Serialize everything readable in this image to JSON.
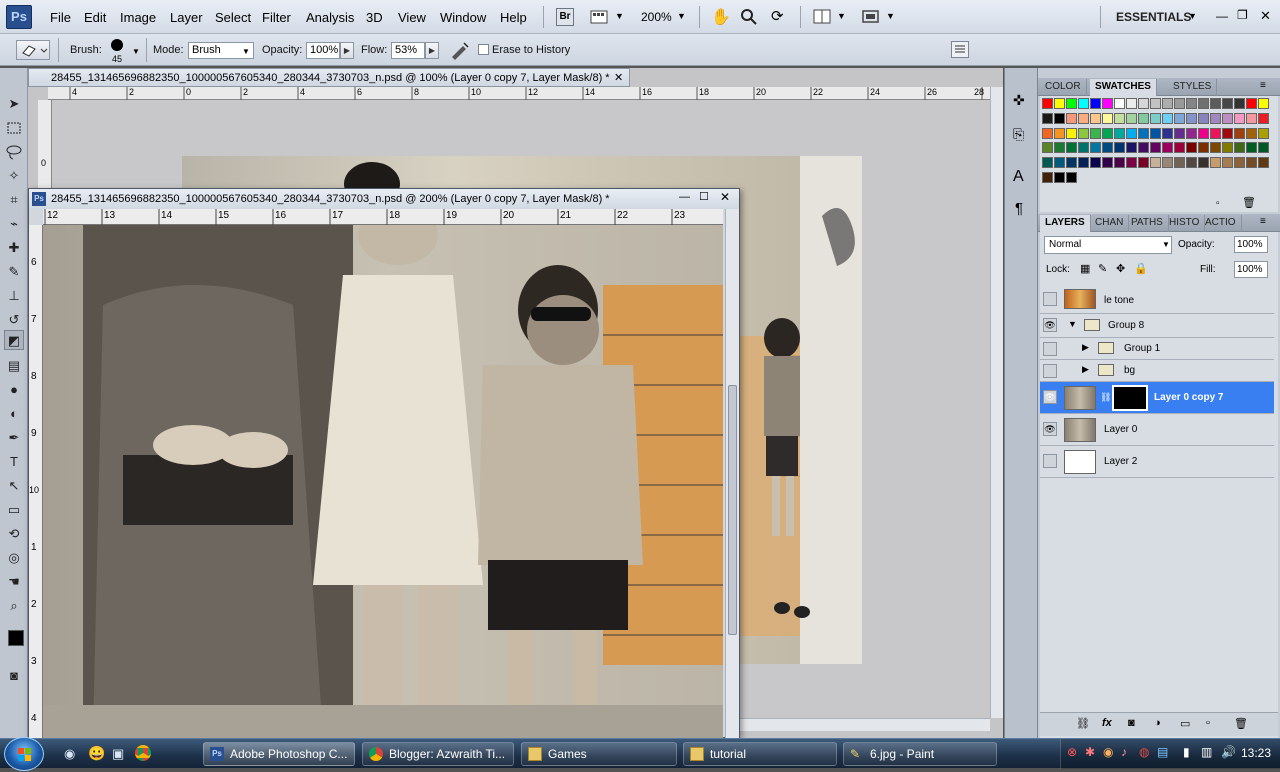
{
  "app": {
    "logo_text": "Ps",
    "menu": [
      "File",
      "Edit",
      "Image",
      "Layer",
      "Select",
      "Filter",
      "Analysis",
      "3D",
      "View",
      "Window",
      "Help"
    ],
    "br_label": "Br",
    "zoom_level": "200%",
    "workspace": "ESSENTIALS"
  },
  "options": {
    "brush_label": "Brush:",
    "brush_size": "45",
    "mode_label": "Mode:",
    "mode_value": "Brush",
    "opacity_label": "Opacity:",
    "opacity_value": "100%",
    "flow_label": "Flow:",
    "flow_value": "53%",
    "erase_history": "Erase to History"
  },
  "documents": {
    "back_title": "28455_131465696882350_100000567605340_280344_3730703_n.psd @ 100% (Layer 0 copy 7, Layer Mask/8) *",
    "front_title": "28455_131465696882350_100000567605340_280344_3730703_n.psd @ 200% (Layer 0 copy 7, Layer Mask/8) *",
    "back_ruler": [
      "4",
      "2",
      "0",
      "2",
      "4",
      "6",
      "8",
      "10",
      "12",
      "14",
      "16",
      "18",
      "20",
      "22",
      "24",
      "26",
      "28"
    ],
    "back_ruler_v": [
      "0"
    ],
    "front_ruler": [
      "12",
      "13",
      "14",
      "15",
      "16",
      "17",
      "18",
      "19",
      "20",
      "21",
      "22",
      "23"
    ],
    "front_ruler_v": [
      "6",
      "7",
      "8",
      "9",
      "10",
      "1",
      "2",
      "3",
      "4"
    ]
  },
  "panels": {
    "top_tabs": [
      "COLOR",
      "SWATCHES",
      "STYLES"
    ],
    "layer_tabs": [
      "LAYERS",
      "CHAN",
      "PATHS",
      "HISTO",
      "ACTIO"
    ],
    "blend_mode": "Normal",
    "opacity_label": "Opacity:",
    "opacity_value": "100%",
    "lock_label": "Lock:",
    "fill_label": "Fill:",
    "fill_value": "100%",
    "layers": [
      {
        "name": "le tone",
        "visible": false
      },
      {
        "name": "Group 8",
        "visible": true
      },
      {
        "name": "Group 1",
        "visible": false
      },
      {
        "name": "bg",
        "visible": false
      },
      {
        "name": "Layer 0 copy 7",
        "visible": true,
        "selected": true
      },
      {
        "name": "Layer 0",
        "visible": true
      },
      {
        "name": "Layer 2",
        "visible": false
      }
    ],
    "swatch_colors": [
      "#ff0000",
      "#ffff00",
      "#00ff00",
      "#00ffff",
      "#0000ff",
      "#ff00ff",
      "#ffffff",
      "#ebebeb",
      "#d6d6d6",
      "#c2c2c2",
      "#adadad",
      "#999999",
      "#858585",
      "#707070",
      "#5c5c5c",
      "#474747",
      "#333333",
      "#ff0000",
      "#ffff00",
      "#1a1a1a",
      "#000000",
      "#f7977a",
      "#f9ad81",
      "#fdc68a",
      "#fff79a",
      "#c4df9b",
      "#a3d39c",
      "#82ca9d",
      "#7bcdc8",
      "#6ecff6",
      "#7ea7d8",
      "#8493ca",
      "#8882be",
      "#a187be",
      "#bc8dbf",
      "#f49ac2",
      "#f6989d",
      "#ed1c24",
      "#f26522",
      "#f7941d",
      "#fff200",
      "#8dc73f",
      "#39b54a",
      "#00a651",
      "#00a99d",
      "#00aeef",
      "#0072bc",
      "#0054a6",
      "#2e3192",
      "#662d91",
      "#92278f",
      "#ec008c",
      "#ed145b",
      "#9e0b0f",
      "#a0410d",
      "#a36209",
      "#aba000",
      "#598527",
      "#1a7b30",
      "#007236",
      "#00746b",
      "#0076a3",
      "#004b80",
      "#003471",
      "#1b1464",
      "#440e62",
      "#630460",
      "#9e005d",
      "#9e0039",
      "#790000",
      "#7b2e00",
      "#7d4900",
      "#827b00",
      "#406618",
      "#005e20",
      "#005826",
      "#005952",
      "#005b7f",
      "#003663",
      "#002157",
      "#0d004c",
      "#32004b",
      "#4b0049",
      "#7b0046",
      "#7a0026",
      "#c7b299",
      "#998675",
      "#736357",
      "#534741",
      "#37302d",
      "#c69c6d",
      "#a67c52",
      "#8c6239",
      "#754c24",
      "#603913",
      "#42210b",
      "#000000",
      "#000000"
    ]
  },
  "taskbar": {
    "items": [
      "Adobe Photoshop C...",
      "Blogger: Azwraith Ti...",
      "Games",
      "tutorial",
      "6.jpg - Paint"
    ],
    "clock": "13:23"
  }
}
